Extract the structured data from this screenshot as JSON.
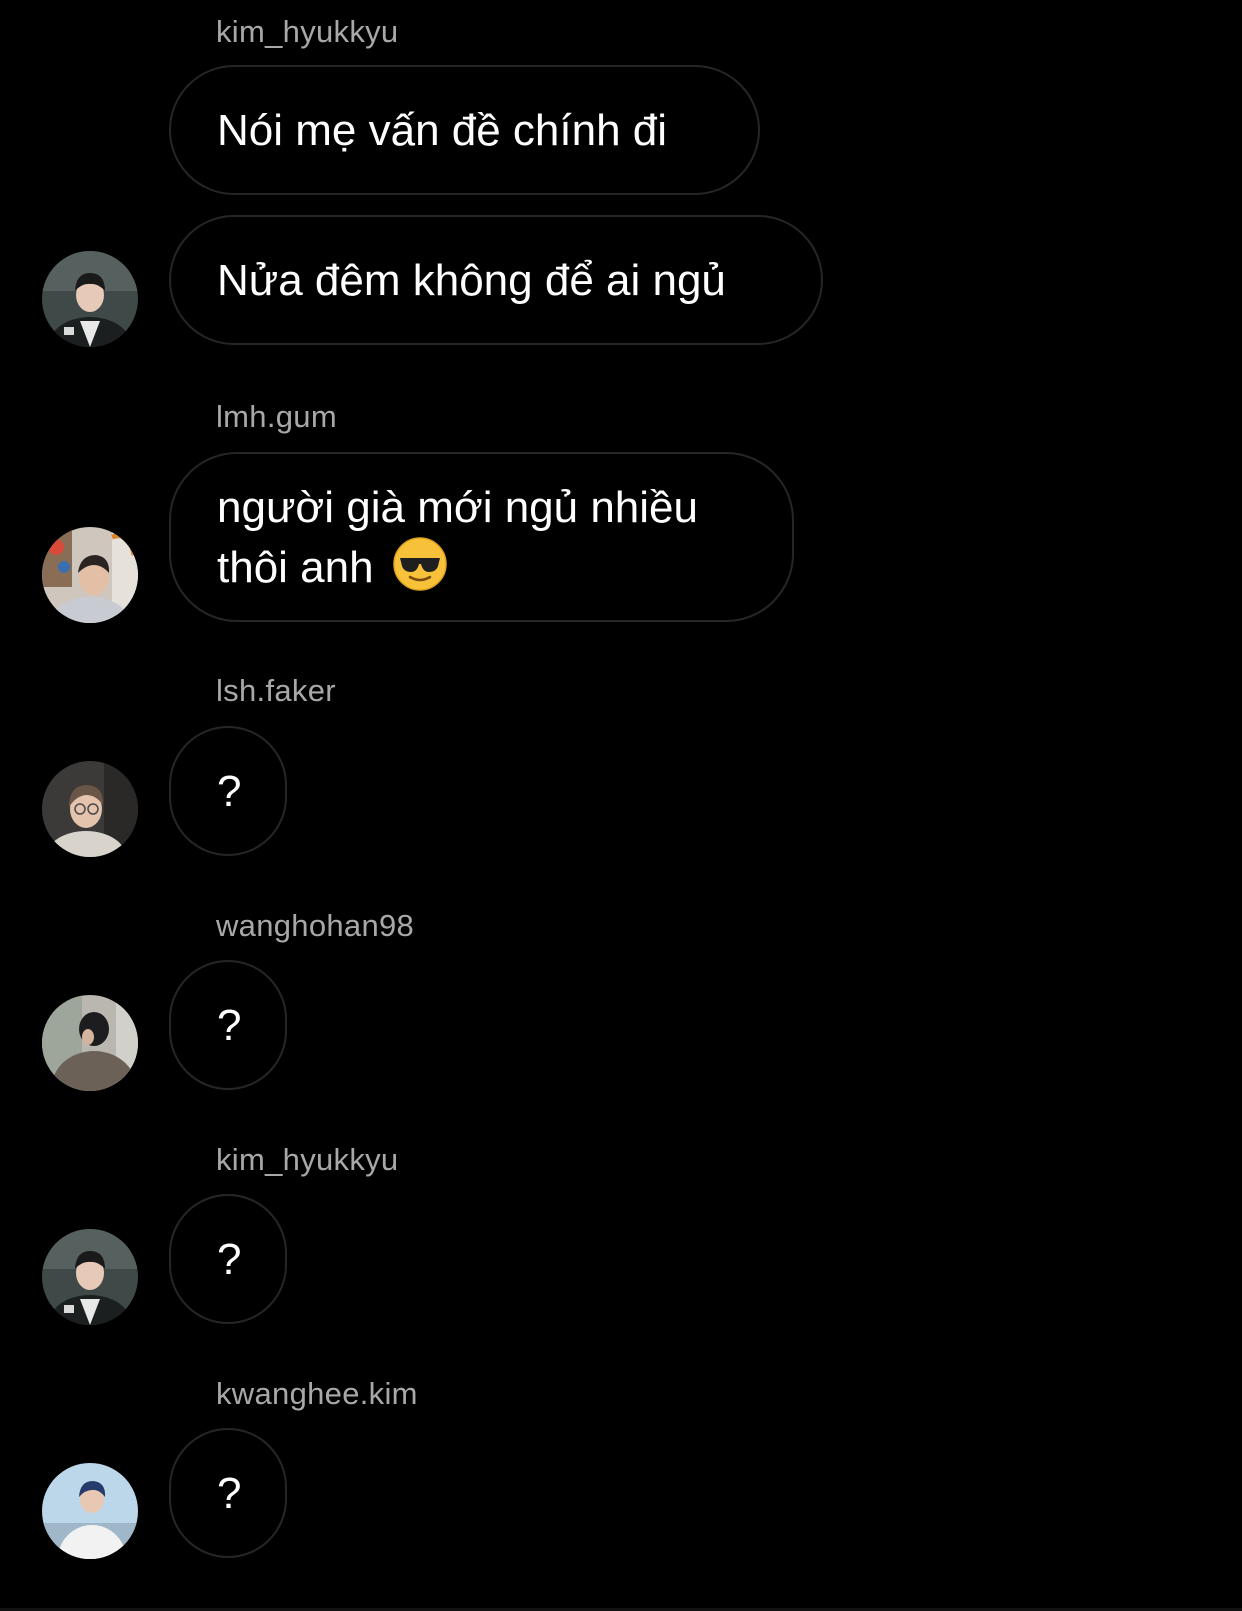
{
  "messages": [
    {
      "sender": "kim_hyukkyu"
    },
    {
      "text": "Nói mẹ vấn đề chính đi"
    },
    {
      "text": "Nửa đêm không để ai ngủ",
      "avatar": "avatar-kim-hyukkyu"
    },
    {
      "sender": "lmh.gum"
    },
    {
      "line1": "người già mới ngủ nhiều",
      "line2": "thôi anh",
      "emoji": "sunglasses-emoji",
      "avatar": "avatar-lmh-gum"
    },
    {
      "sender": "lsh.faker"
    },
    {
      "text": "?",
      "avatar": "avatar-lsh-faker"
    },
    {
      "sender": "wanghohan98"
    },
    {
      "text": "?",
      "avatar": "avatar-wanghohan98"
    },
    {
      "sender": "kim_hyukkyu"
    },
    {
      "text": "?",
      "avatar": "avatar-kim-hyukkyu"
    },
    {
      "sender": "kwanghee.kim"
    },
    {
      "text": "?",
      "avatar": "avatar-kwanghee-kim"
    }
  ],
  "colors": {
    "background": "#000000",
    "bubble_border": "#262626",
    "sender_text": "#a8a8a8",
    "message_text": "#ffffff"
  }
}
